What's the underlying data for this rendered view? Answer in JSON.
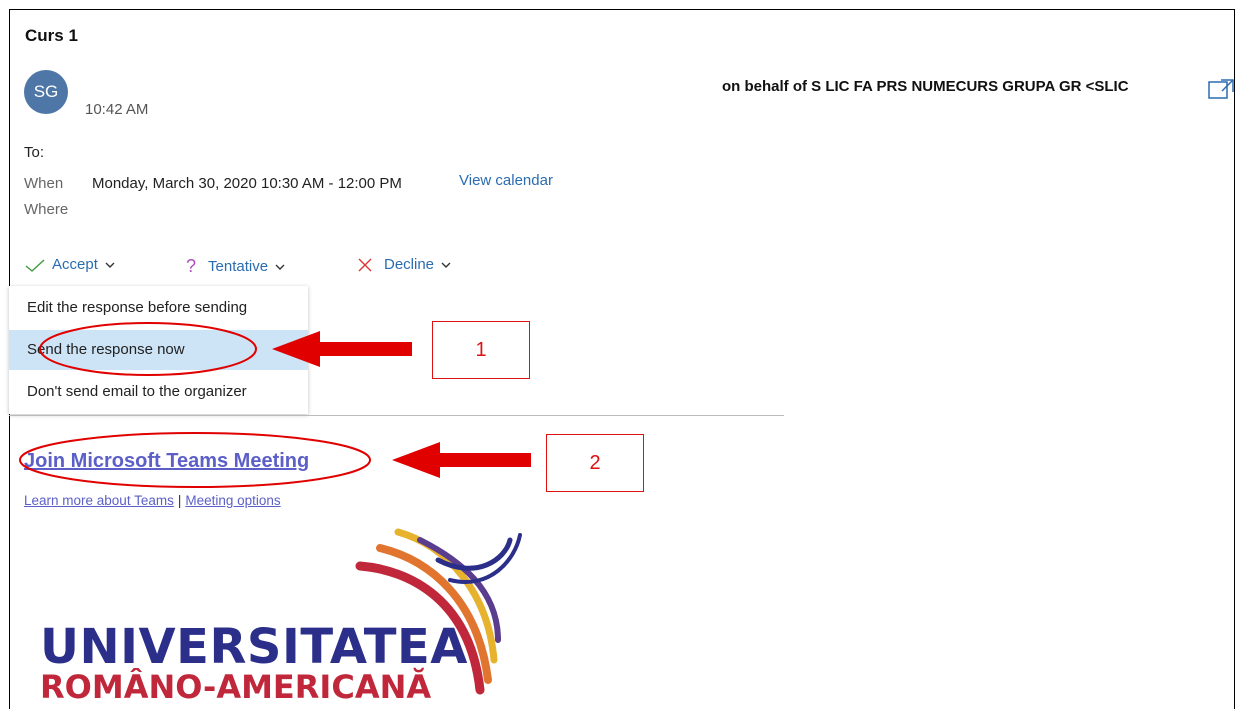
{
  "meeting": {
    "title": "Curs 1",
    "avatar_initials": "SG",
    "time": "10:42 AM",
    "on_behalf": "on behalf of S LIC FA PRS NUMECURS GRUPA GR <SLIC",
    "to_label": "To:",
    "when_label": "When",
    "when_value": "Monday, March 30, 2020 10:30 AM - 12:00 PM",
    "view_calendar": "View calendar",
    "where_label": "Where"
  },
  "responses": {
    "accept": "Accept",
    "tentative": "Tentative",
    "decline": "Decline"
  },
  "dropdown": {
    "items": [
      "Edit the response before sending",
      "Send the response now",
      "Don't send email to the organizer"
    ],
    "selected_index": 1
  },
  "teams": {
    "join_link": "Join Microsoft Teams Meeting",
    "learn_more": "Learn more about Teams",
    "separator": "|",
    "meeting_options": "Meeting options"
  },
  "annotations": {
    "step1": "1",
    "step2": "2"
  },
  "logo": {
    "line1": "UNIVERSITATEA",
    "line2": "ROMÂNO-AMERICANĂ"
  },
  "colors": {
    "accent_blue": "#2b6cb0",
    "teams_purple": "#5b5fc7",
    "annotation_red": "#e00000",
    "selected_bg": "#cde3f6",
    "avatar_bg": "#4e77a8"
  }
}
